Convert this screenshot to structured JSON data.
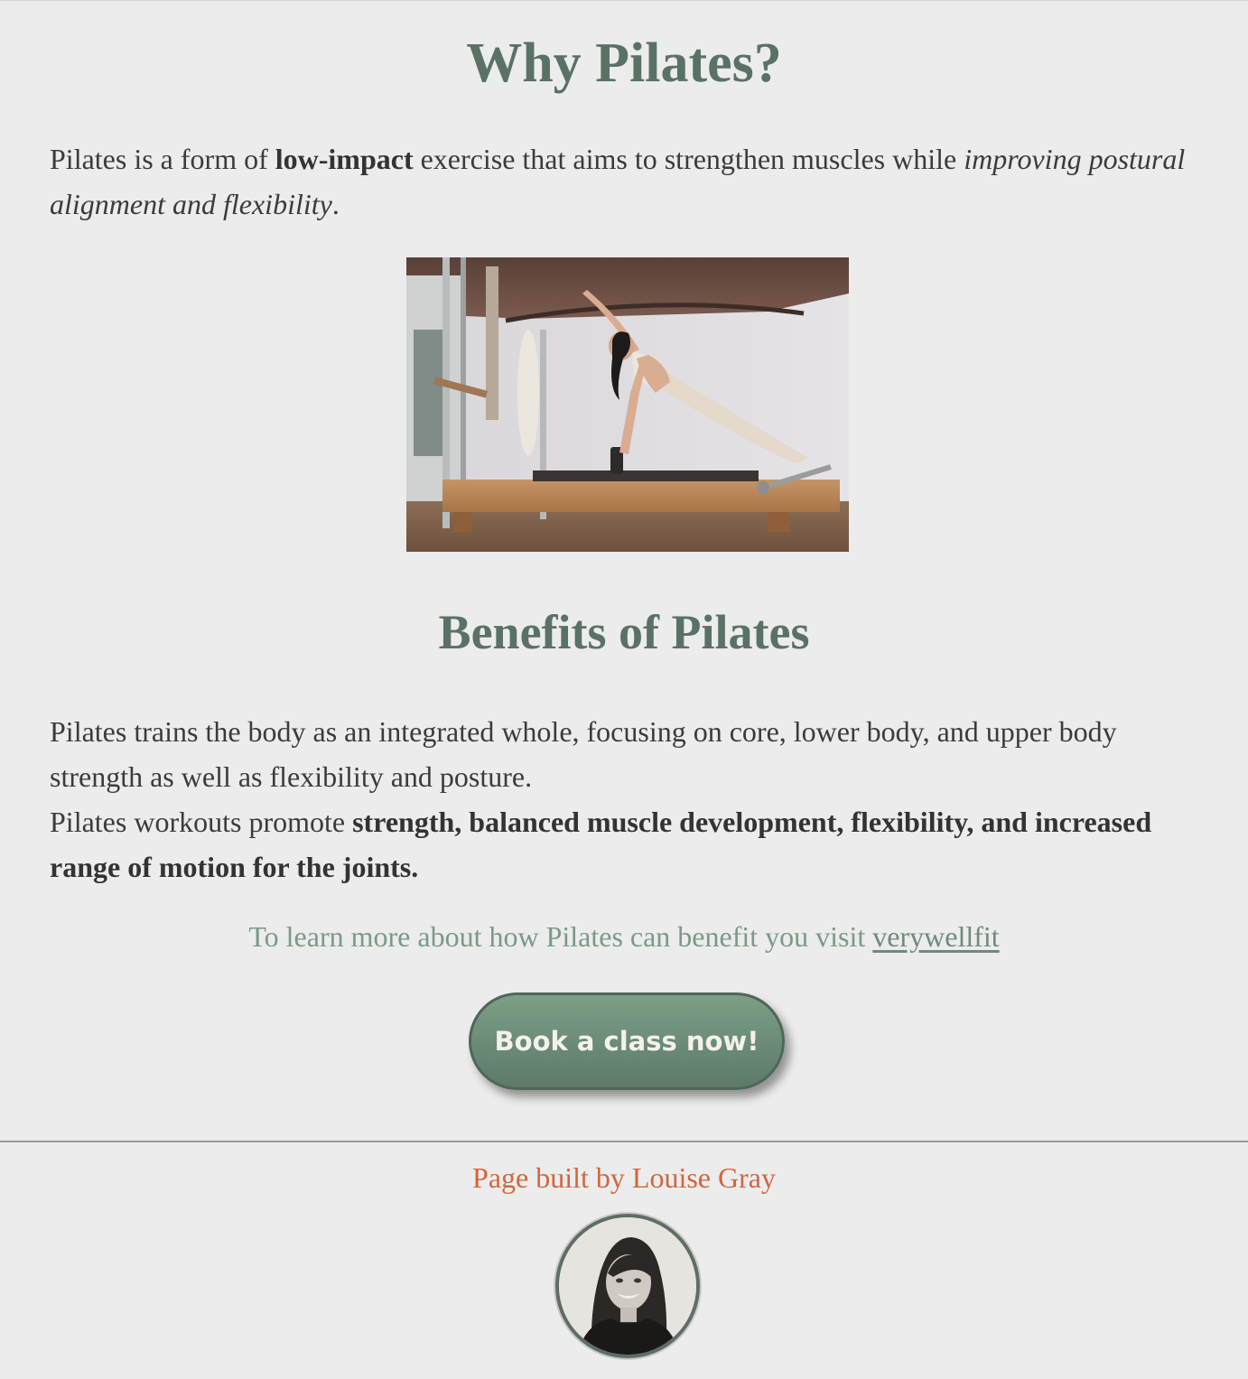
{
  "why": {
    "title": "Why Pilates?",
    "p1_a": "Pilates is a form of ",
    "p1_bold": "low-impact",
    "p1_b": " exercise that aims to strengthen muscles while ",
    "p1_italic": "improving postural alignment and flexibility",
    "p1_end": "."
  },
  "benefits": {
    "title": "Benefits of Pilates",
    "p2": "Pilates trains the body as an integrated whole, focusing on core, lower body, and upper body strength as well as flexibility and posture.",
    "p3_a": "Pilates workouts promote ",
    "p3_bold": "strength, balanced muscle development, flexibility, and increased range of motion for the joints."
  },
  "learn": {
    "text": "To learn more about how Pilates can benefit you visit ",
    "link": "verywellfit"
  },
  "cta": {
    "label": "Book a class now!"
  },
  "footer": {
    "credit": "Page built by Louise Gray"
  },
  "colors": {
    "heading": "#5a7265",
    "background": "#ececec",
    "accent_orange": "#d1663e",
    "button_green": "#6a8a76"
  }
}
